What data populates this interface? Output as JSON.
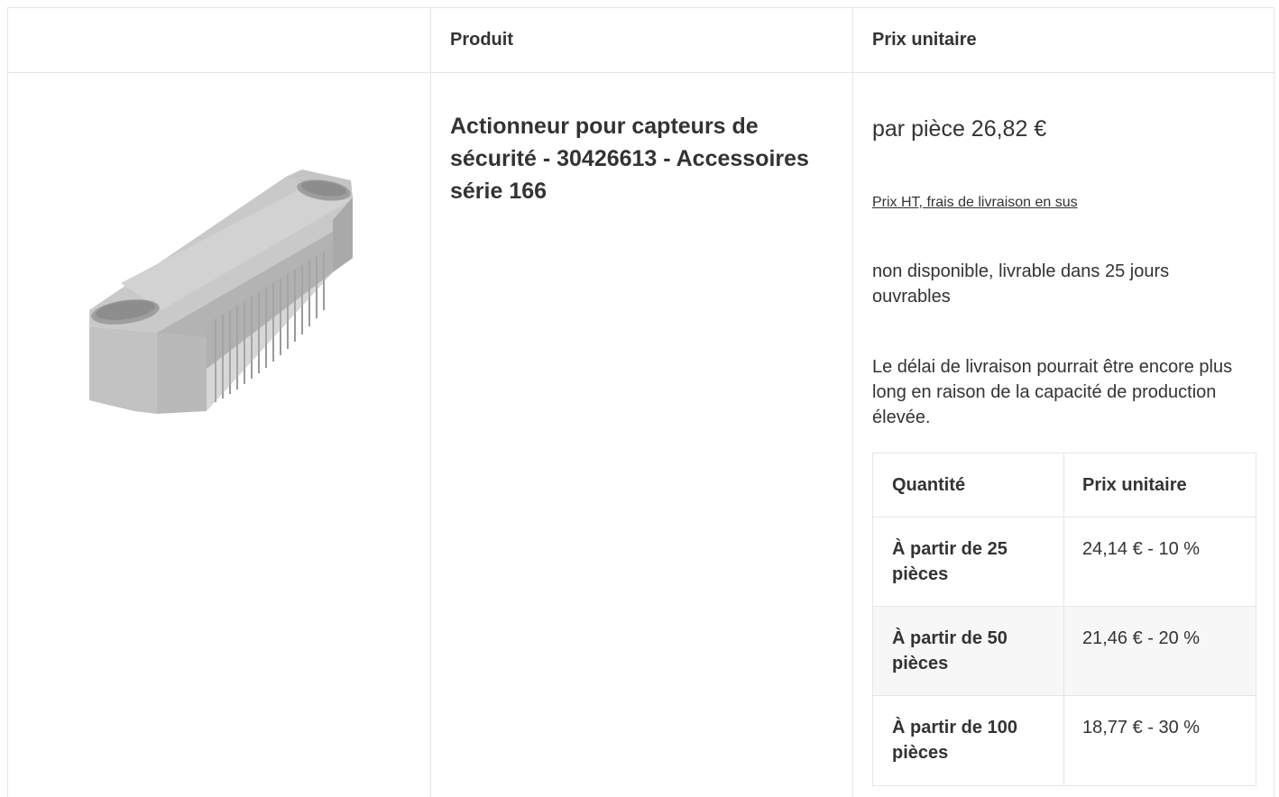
{
  "table": {
    "headers": {
      "image": "",
      "product": "Produit",
      "unit_price": "Prix unitaire"
    }
  },
  "product": {
    "title": "Actionneur pour capteurs de sécurité - 30426613 - Accessoires série 166",
    "image_description_icon": "actuator-product-image"
  },
  "pricing": {
    "per_piece": "par pièce 26,82 €",
    "tax_note": "Prix HT, frais de livraison en sus ",
    "availability": "non disponible, livrable dans 25 jours ouvrables",
    "delay_note": "Le délai de livraison pourrait être encore plus long en raison de la capacité de production élevée."
  },
  "quantity_table": {
    "headers": {
      "quantity": "Quantité",
      "unit_price": "Prix unitaire"
    },
    "rows": [
      {
        "quantity": "À partir de 25 pièces",
        "price": "24,14 € - 10 %"
      },
      {
        "quantity": "À partir de 50 pièces",
        "price": "21,46 € - 20 %"
      },
      {
        "quantity": "À partir de 100 pièces",
        "price": "18,77 € - 30 %"
      }
    ]
  },
  "colors": {
    "border": "#e6e6e6",
    "text": "#333333",
    "alt_row": "#f7f7f7",
    "product_gray": "#bdbdbd"
  }
}
